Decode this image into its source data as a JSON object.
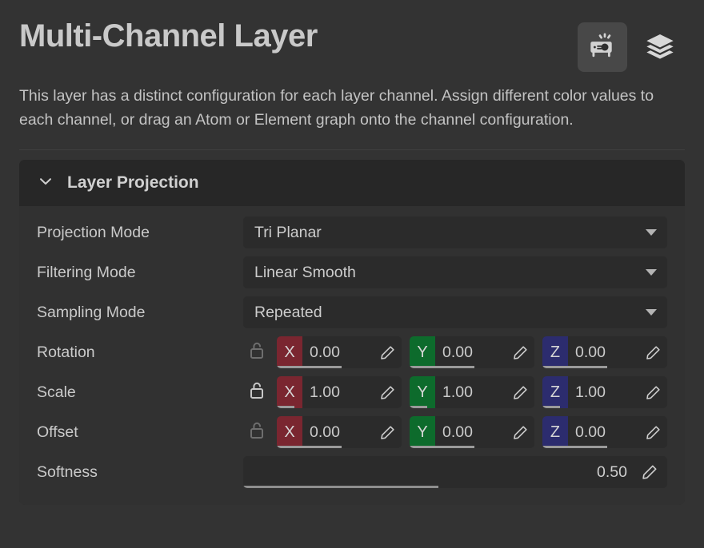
{
  "header": {
    "title": "Multi-Channel Layer",
    "description": "This layer has a distinct configuration for each layer channel. Assign different color values to each channel, or drag an Atom or Element graph onto the channel configuration.",
    "actions": [
      {
        "icon": "projector-icon",
        "name": "projector-button",
        "active": true
      },
      {
        "icon": "layers-icon",
        "name": "layers-button",
        "active": false
      }
    ]
  },
  "panel": {
    "title": "Layer Projection",
    "collapse_icon": "chevron-down-icon",
    "expanded": true
  },
  "rows": {
    "projection_mode": {
      "label": "Projection Mode",
      "value": "Tri Planar"
    },
    "filtering_mode": {
      "label": "Filtering Mode",
      "value": "Linear Smooth"
    },
    "sampling_mode": {
      "label": "Sampling Mode",
      "value": "Repeated"
    },
    "rotation": {
      "label": "Rotation",
      "lock": "unlock-icon",
      "lock_active": false,
      "x": "0.00",
      "y": "0.00",
      "z": "0.00"
    },
    "scale": {
      "label": "Scale",
      "lock": "unlock-icon",
      "lock_active": true,
      "x": "1.00",
      "y": "1.00",
      "z": "1.00"
    },
    "offset": {
      "label": "Offset",
      "lock": "unlock-icon",
      "lock_active": false,
      "x": "0.00",
      "y": "0.00",
      "z": "0.00"
    },
    "softness": {
      "label": "Softness",
      "value": "0.50",
      "fill_percent": "46%"
    }
  },
  "axis_labels": {
    "x": "X",
    "y": "Y",
    "z": "Z"
  },
  "colors": {
    "axis_x": "#7a2630",
    "axis_y": "#0d6b2c",
    "axis_z": "#2c2c6e",
    "panel_bg": "#313131",
    "page_bg": "#333333",
    "field_bg": "#2b2b2b"
  }
}
